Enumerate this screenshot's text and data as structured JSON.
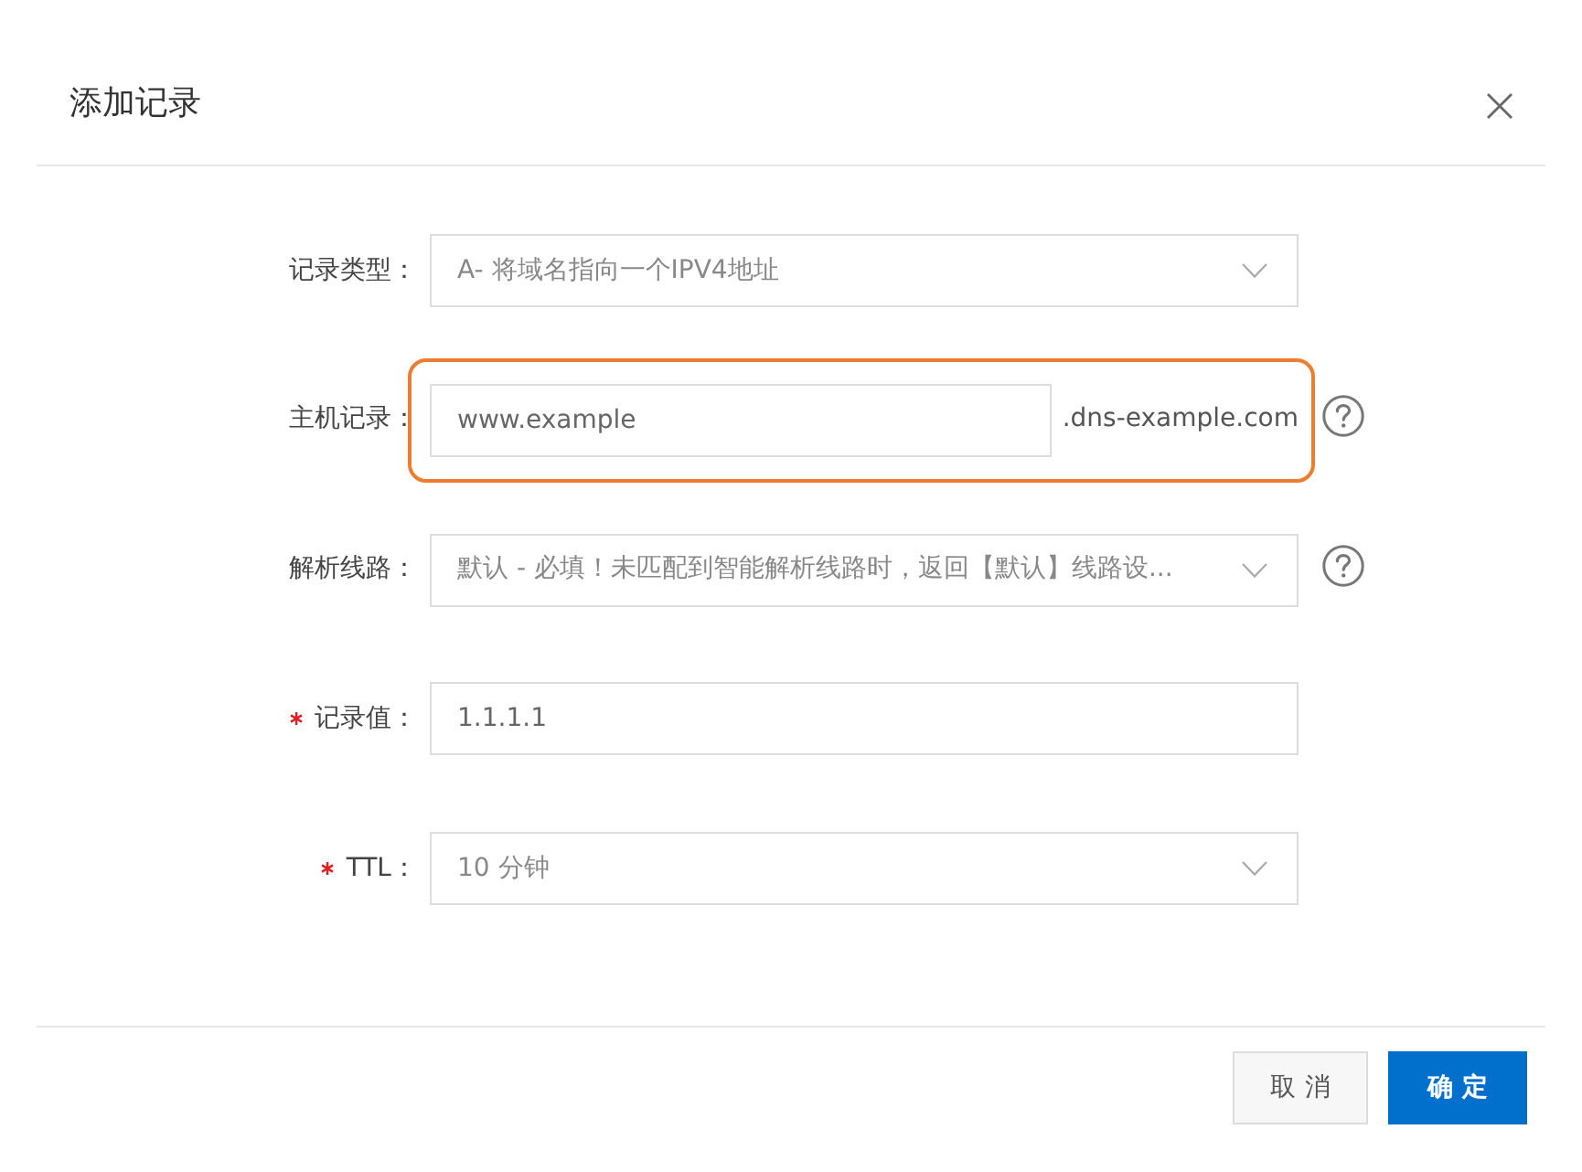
{
  "dialog": {
    "title": "添加记录"
  },
  "fields": [
    {
      "kind": "select",
      "label": "记录类型：",
      "required": false,
      "value": "A- 将域名指向一个IPV4地址",
      "highlighted": false,
      "help": false
    },
    {
      "kind": "input",
      "label": "主机记录：",
      "required": false,
      "value": "www.example",
      "suffix": ".dns-example.com",
      "highlighted": true,
      "help": true
    },
    {
      "kind": "select",
      "label": "解析线路：",
      "required": false,
      "value": "默认 - 必填！未匹配到智能解析线路时，返回【默认】线路设...",
      "highlighted": false,
      "help": true
    },
    {
      "kind": "input",
      "label": "记录值：",
      "required": true,
      "value": "1.1.1.1",
      "highlighted": false,
      "help": false
    },
    {
      "kind": "select",
      "label": "TTL：",
      "required": true,
      "value": "10 分钟",
      "highlighted": false,
      "help": false
    }
  ],
  "buttons": [
    {
      "label": "取消",
      "kind": "secondary"
    },
    {
      "label": "确定",
      "kind": "primary"
    }
  ]
}
